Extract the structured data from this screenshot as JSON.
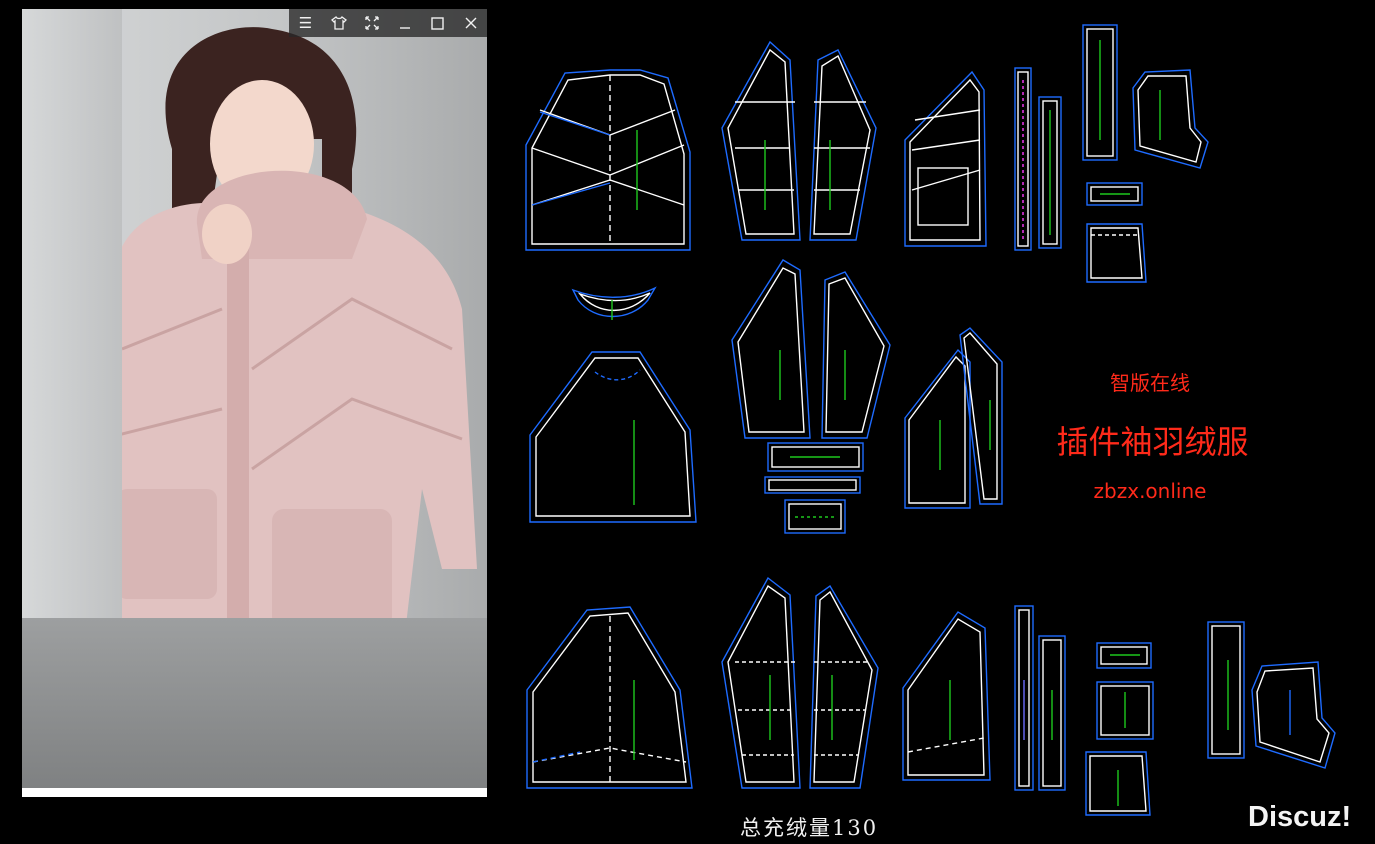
{
  "viewer": {
    "toolbar": [
      {
        "name": "menu-icon",
        "glyph": "☰"
      },
      {
        "name": "shirt-icon",
        "glyph": "👕"
      },
      {
        "name": "fit-screen-icon",
        "glyph": "⤧"
      },
      {
        "name": "minimize-icon",
        "glyph": "—"
      },
      {
        "name": "maximize-icon",
        "glyph": "☐"
      },
      {
        "name": "close-icon",
        "glyph": "✕"
      }
    ],
    "photo_subject": "model-wearing-pink-hooded-down-jacket"
  },
  "branding": {
    "subtitle": "智版在线",
    "title": "插件袖羽绒服",
    "url": "zbzx.online",
    "color": "#ff2a1a"
  },
  "footer": {
    "fill_total": "总充绒量130",
    "watermark": "Discuz!"
  },
  "pattern_colors": {
    "outline": "#ffffff",
    "seam_allowance": "#1e6bff",
    "grainline": "#1ec81e",
    "marker": "#ff3cff"
  }
}
